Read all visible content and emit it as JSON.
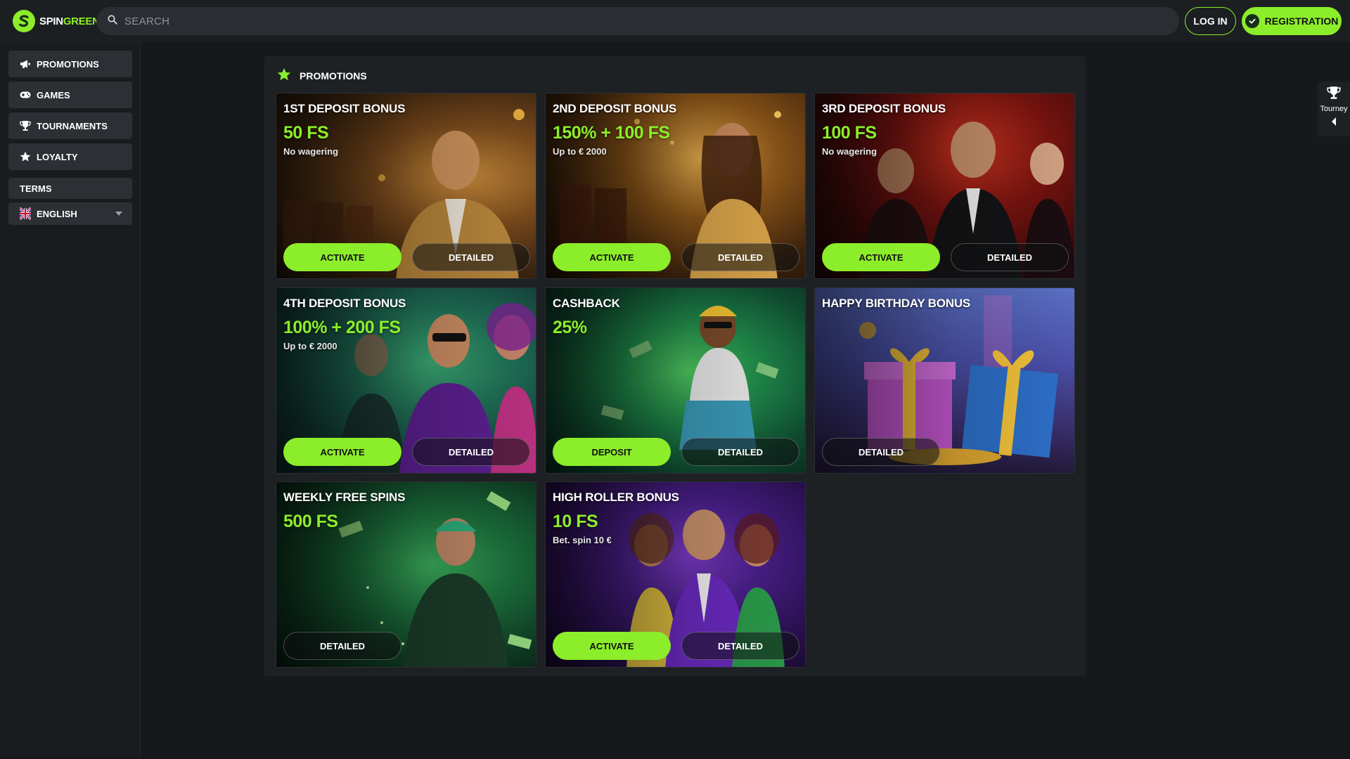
{
  "brand": {
    "part1": "SPIN",
    "part2": "GREEN",
    "accent": "#8ced2a"
  },
  "header": {
    "search_placeholder": "SEARCH",
    "login_label": "LOG IN",
    "register_label": "REGISTRATION"
  },
  "sidebar": {
    "items": [
      {
        "label": "PROMOTIONS",
        "icon": "megaphone-icon"
      },
      {
        "label": "GAMES",
        "icon": "gamepad-icon"
      },
      {
        "label": "TOURNAMENTS",
        "icon": "trophy-icon"
      },
      {
        "label": "LOYALTY",
        "icon": "star-icon"
      }
    ],
    "terms_label": "TERMS",
    "language": {
      "label": "ENGLISH",
      "icon": "uk-flag-icon"
    }
  },
  "main": {
    "title": "PROMOTIONS",
    "title_icon": "star-icon",
    "cards": [
      {
        "title": "1ST DEPOSIT BONUS",
        "value": "50 FS",
        "sub": "No wagering",
        "primary": "ACTIVATE",
        "detail": "DETAILED"
      },
      {
        "title": "2ND DEPOSIT BONUS",
        "value": "150% + 100 FS",
        "sub": "Up to € 2000",
        "primary": "ACTIVATE",
        "detail": "DETAILED"
      },
      {
        "title": "3RD DEPOSIT BONUS",
        "value": "100 FS",
        "sub": "No wagering",
        "primary": "ACTIVATE",
        "detail": "DETAILED"
      },
      {
        "title": "4TH DEPOSIT BONUS",
        "value": "100% + 200 FS",
        "sub": "Up to € 2000",
        "primary": "ACTIVATE",
        "detail": "DETAILED"
      },
      {
        "title": "CASHBACK",
        "value": "25%",
        "sub": "",
        "primary": "DEPOSIT",
        "detail": "DETAILED"
      },
      {
        "title": "HAPPY BIRTHDAY BONUS",
        "value": "",
        "sub": "",
        "primary": "",
        "detail": "DETAILED"
      },
      {
        "title": "WEEKLY FREE SPINS",
        "value": "500 FS",
        "sub": "",
        "primary": "",
        "detail": "DETAILED"
      },
      {
        "title": "HIGH ROLLER BONUS",
        "value": "10 FS",
        "sub": "Bet. spin 10 €",
        "primary": "ACTIVATE",
        "detail": "DETAILED"
      }
    ]
  },
  "right_tab": {
    "label": "Tourney",
    "icon": "trophy-icon"
  }
}
